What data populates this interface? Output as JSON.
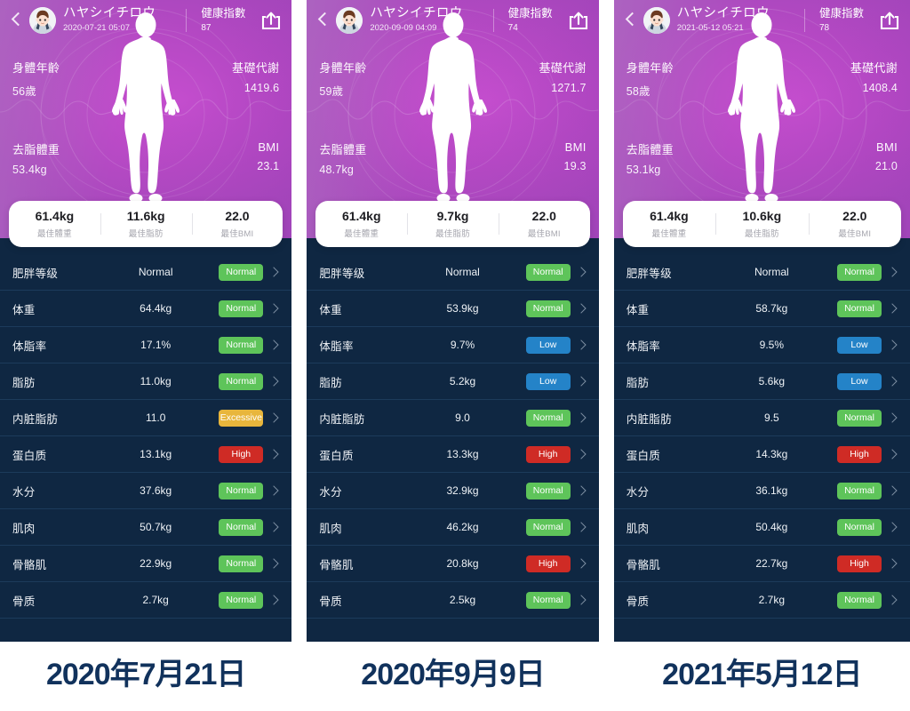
{
  "panels": [
    {
      "caption": "2020年7月21日",
      "header": {
        "back_icon": "chevron-left-icon",
        "avatar_icon": "user-avatar-icon",
        "name": "ハヤシイチロウ",
        "datetime": "2020-07-21 05:07",
        "score_label": "健康指數",
        "score_value": "87",
        "share_icon": "share-icon"
      },
      "hero": {
        "body_age_label": "身體年齡",
        "body_age_value": "56歲",
        "bmr_label": "基礎代謝",
        "bmr_value": "1419.6",
        "fat_free_label": "去脂體重",
        "fat_free_value": "53.4kg",
        "bmi_label": "BMI",
        "bmi_value": "23.1"
      },
      "summary": [
        {
          "value": "61.4kg",
          "label": "最佳體重"
        },
        {
          "value": "11.6kg",
          "label": "最佳脂肪"
        },
        {
          "value": "22.0",
          "label": "最佳BMI"
        }
      ],
      "rows": [
        {
          "label": "肥胖等级",
          "value": "Normal",
          "status": "Normal",
          "status_class": "normal"
        },
        {
          "label": "体重",
          "value": "64.4kg",
          "status": "Normal",
          "status_class": "normal"
        },
        {
          "label": "体脂率",
          "value": "17.1%",
          "status": "Normal",
          "status_class": "normal"
        },
        {
          "label": "脂肪",
          "value": "11.0kg",
          "status": "Normal",
          "status_class": "normal"
        },
        {
          "label": "内脏脂肪",
          "value": "11.0",
          "status": "Excessive",
          "status_class": "excessive"
        },
        {
          "label": "蛋白质",
          "value": "13.1kg",
          "status": "High",
          "status_class": "high"
        },
        {
          "label": "水分",
          "value": "37.6kg",
          "status": "Normal",
          "status_class": "normal"
        },
        {
          "label": "肌肉",
          "value": "50.7kg",
          "status": "Normal",
          "status_class": "normal"
        },
        {
          "label": "骨骼肌",
          "value": "22.9kg",
          "status": "Normal",
          "status_class": "normal"
        },
        {
          "label": "骨质",
          "value": "2.7kg",
          "status": "Normal",
          "status_class": "normal"
        }
      ]
    },
    {
      "caption": "2020年9月9日",
      "header": {
        "back_icon": "chevron-left-icon",
        "avatar_icon": "user-avatar-icon",
        "name": "ハヤシイチロウ",
        "datetime": "2020-09-09 04:09",
        "score_label": "健康指數",
        "score_value": "74",
        "share_icon": "share-icon"
      },
      "hero": {
        "body_age_label": "身體年齡",
        "body_age_value": "59歲",
        "bmr_label": "基礎代謝",
        "bmr_value": "1271.7",
        "fat_free_label": "去脂體重",
        "fat_free_value": "48.7kg",
        "bmi_label": "BMI",
        "bmi_value": "19.3"
      },
      "summary": [
        {
          "value": "61.4kg",
          "label": "最佳體重"
        },
        {
          "value": "9.7kg",
          "label": "最佳脂肪"
        },
        {
          "value": "22.0",
          "label": "最佳BMI"
        }
      ],
      "rows": [
        {
          "label": "肥胖等级",
          "value": "Normal",
          "status": "Normal",
          "status_class": "normal"
        },
        {
          "label": "体重",
          "value": "53.9kg",
          "status": "Normal",
          "status_class": "normal"
        },
        {
          "label": "体脂率",
          "value": "9.7%",
          "status": "Low",
          "status_class": "low"
        },
        {
          "label": "脂肪",
          "value": "5.2kg",
          "status": "Low",
          "status_class": "low"
        },
        {
          "label": "内脏脂肪",
          "value": "9.0",
          "status": "Normal",
          "status_class": "normal"
        },
        {
          "label": "蛋白质",
          "value": "13.3kg",
          "status": "High",
          "status_class": "high"
        },
        {
          "label": "水分",
          "value": "32.9kg",
          "status": "Normal",
          "status_class": "normal"
        },
        {
          "label": "肌肉",
          "value": "46.2kg",
          "status": "Normal",
          "status_class": "normal"
        },
        {
          "label": "骨骼肌",
          "value": "20.8kg",
          "status": "High",
          "status_class": "high"
        },
        {
          "label": "骨质",
          "value": "2.5kg",
          "status": "Normal",
          "status_class": "normal"
        }
      ]
    },
    {
      "caption": "2021年5月12日",
      "header": {
        "back_icon": "chevron-left-icon",
        "avatar_icon": "user-avatar-icon",
        "name": "ハヤシイチロウ",
        "datetime": "2021-05-12 05:21",
        "score_label": "健康指數",
        "score_value": "78",
        "share_icon": "share-icon"
      },
      "hero": {
        "body_age_label": "身體年齡",
        "body_age_value": "58歲",
        "bmr_label": "基礎代謝",
        "bmr_value": "1408.4",
        "fat_free_label": "去脂體重",
        "fat_free_value": "53.1kg",
        "bmi_label": "BMI",
        "bmi_value": "21.0"
      },
      "summary": [
        {
          "value": "61.4kg",
          "label": "最佳體重"
        },
        {
          "value": "10.6kg",
          "label": "最佳脂肪"
        },
        {
          "value": "22.0",
          "label": "最佳BMI"
        }
      ],
      "rows": [
        {
          "label": "肥胖等级",
          "value": "Normal",
          "status": "Normal",
          "status_class": "normal"
        },
        {
          "label": "体重",
          "value": "58.7kg",
          "status": "Normal",
          "status_class": "normal"
        },
        {
          "label": "体脂率",
          "value": "9.5%",
          "status": "Low",
          "status_class": "low"
        },
        {
          "label": "脂肪",
          "value": "5.6kg",
          "status": "Low",
          "status_class": "low"
        },
        {
          "label": "内脏脂肪",
          "value": "9.5",
          "status": "Normal",
          "status_class": "normal"
        },
        {
          "label": "蛋白质",
          "value": "14.3kg",
          "status": "High",
          "status_class": "high"
        },
        {
          "label": "水分",
          "value": "36.1kg",
          "status": "Normal",
          "status_class": "normal"
        },
        {
          "label": "肌肉",
          "value": "50.4kg",
          "status": "Normal",
          "status_class": "normal"
        },
        {
          "label": "骨骼肌",
          "value": "22.7kg",
          "status": "High",
          "status_class": "high"
        },
        {
          "label": "骨质",
          "value": "2.7kg",
          "status": "Normal",
          "status_class": "normal"
        }
      ]
    }
  ],
  "colors": {
    "panel_bg": "#0f2742",
    "badge_normal": "#5ec45a",
    "badge_low": "#2483c8",
    "badge_high": "#cf2b25",
    "badge_excessive": "#e8b63c",
    "caption": "#11325c"
  }
}
